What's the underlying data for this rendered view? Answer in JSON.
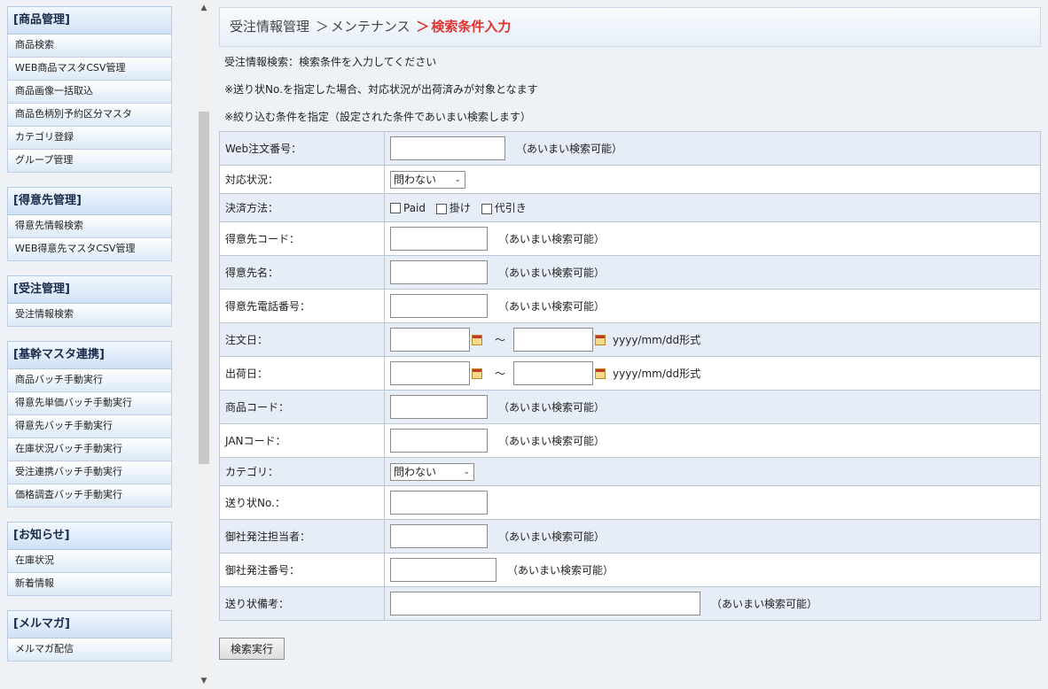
{
  "sidebar": {
    "groups": [
      {
        "title": "[商品管理]",
        "items": [
          "商品検索",
          "WEB商品マスタCSV管理",
          "商品画像一括取込",
          "商品色柄別予約区分マスタ",
          "カテゴリ登録",
          "グループ管理"
        ]
      },
      {
        "title": "[得意先管理]",
        "items": [
          "得意先情報検索",
          "WEB得意先マスタCSV管理"
        ]
      },
      {
        "title": "[受注管理]",
        "items": [
          "受注情報検索"
        ]
      },
      {
        "title": "[基幹マスタ連携]",
        "items": [
          "商品バッチ手動実行",
          "得意先単価バッチ手動実行",
          "得意先バッチ手動実行",
          "在庫状況バッチ手動実行",
          "受注連携バッチ手動実行",
          "価格調査バッチ手動実行"
        ]
      },
      {
        "title": "[お知らせ]",
        "items": [
          "在庫状況",
          "新着情報"
        ]
      },
      {
        "title": "[メルマガ]",
        "items": [
          "メルマガ配信"
        ]
      }
    ]
  },
  "breadcrumb": {
    "level1": "受注情報管理",
    "sep": "＞",
    "level2": "メンテナンス",
    "current": "検索条件入力"
  },
  "notes": [
    "受注情報検索：検索条件を入力してください",
    "※送り状No.を指定した場合、対応状況が出荷済みが対象となます",
    "※絞り込む条件を指定（設定された条件であいまい検索します）"
  ],
  "hint_fuzzy": "（あいまい検索可能）",
  "date_format": "yyyy/mm/dd形式",
  "tilde": "～",
  "form": {
    "web_order_no": "Web注文番号：",
    "status": "対応状況：",
    "status_value": "問わない",
    "payment": "決済方法：",
    "payment_options": [
      "Paid",
      "掛け",
      "代引き"
    ],
    "customer_code": "得意先コード：",
    "customer_name": "得意先名：",
    "customer_phone": "得意先電話番号：",
    "order_date": "注文日：",
    "ship_date": "出荷日：",
    "product_code": "商品コード：",
    "jan_code": "JANコード：",
    "category": "カテゴリ：",
    "category_value": "問わない",
    "invoice_no": "送り状No.：",
    "staff": "御社発注担当者：",
    "order_no": "御社発注番号：",
    "invoice_note": "送り状備考："
  },
  "search_button": "検索実行"
}
